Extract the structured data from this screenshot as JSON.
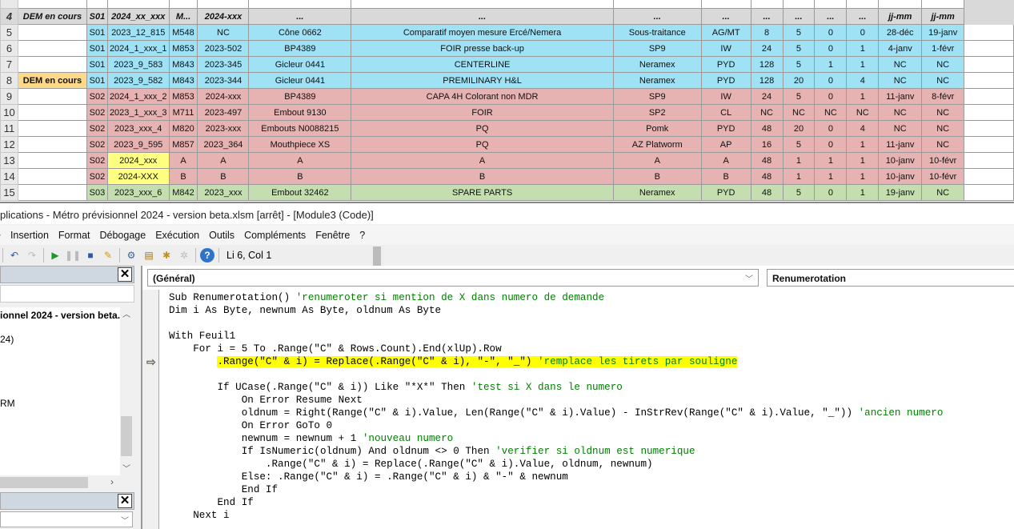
{
  "sheet": {
    "header_row": {
      "row": "4",
      "a": "DEM en cours",
      "cells": [
        "S01",
        "2024_xx_xxx",
        "M...",
        "2024-xxx",
        "...",
        "...",
        "...",
        "...",
        "...",
        "...",
        "...",
        "...",
        "jj-mm",
        "jj-mm"
      ]
    },
    "rows": [
      {
        "row": "5",
        "a": "",
        "color": "blue",
        "cells": [
          "S01",
          "2023_12_815",
          "M548",
          "NC",
          "Cône 0662",
          "Comparatif moyen mesure Ercé/Nemera",
          "Sous-traitance",
          "AG/MT",
          "8",
          "5",
          "0",
          "0",
          "28-déc",
          "19-janv"
        ]
      },
      {
        "row": "6",
        "a": "",
        "color": "blue",
        "cells": [
          "S01",
          "2024_1_xxx_1",
          "M853",
          "2023-502",
          "BP4389",
          "FOIR presse back-up",
          "SP9",
          "IW",
          "24",
          "5",
          "0",
          "1",
          "4-janv",
          "1-févr"
        ]
      },
      {
        "row": "7",
        "a": "",
        "color": "blue",
        "cells": [
          "S01",
          "2023_9_583",
          "M843",
          "2023-345",
          "Gicleur 0441",
          "CENTERLINE",
          "Neramex",
          "PYD",
          "128",
          "5",
          "1",
          "1",
          "NC",
          "NC"
        ]
      },
      {
        "row": "8",
        "a": "DEM en cours",
        "color": "blue",
        "cells": [
          "S01",
          "2023_9_582",
          "M843",
          "2023-344",
          "Gicleur 0441",
          "PREMILINARY H&L",
          "Neramex",
          "PYD",
          "128",
          "20",
          "0",
          "4",
          "NC",
          "NC"
        ]
      },
      {
        "row": "9",
        "a": "",
        "color": "pink",
        "cells": [
          "S02",
          "2024_1_xxx_2",
          "M853",
          "2024-xxx",
          "BP4389",
          "CAPA 4H Colorant non MDR",
          "SP9",
          "IW",
          "24",
          "5",
          "0",
          "1",
          "11-janv",
          "8-févr"
        ]
      },
      {
        "row": "10",
        "a": "",
        "color": "pink",
        "cells": [
          "S02",
          "2023_1_xxx_3",
          "M711",
          "2023-497",
          "Embout 9130",
          "FOIR",
          "SP2",
          "CL",
          "NC",
          "NC",
          "NC",
          "NC",
          "NC",
          "NC"
        ]
      },
      {
        "row": "11",
        "a": "",
        "color": "pink",
        "cells": [
          "S02",
          "2023_xxx_4",
          "M820",
          "2023-xxx",
          "Embouts N0088215",
          "PQ",
          "Pomk",
          "PYD",
          "48",
          "20",
          "0",
          "4",
          "NC",
          "NC"
        ]
      },
      {
        "row": "12",
        "a": "",
        "color": "pink",
        "cells": [
          "S02",
          "2023_9_595",
          "M857",
          "2023_364",
          "Mouthpiece XS",
          "PQ",
          "AZ Platworm",
          "AP",
          "16",
          "5",
          "0",
          "1",
          "11-janv",
          "NC"
        ]
      },
      {
        "row": "13",
        "a": "",
        "color": "pink",
        "yellow": true,
        "cells": [
          "S02",
          "2024_xxx",
          "A",
          "A",
          "A",
          "A",
          "A",
          "A",
          "48",
          "1",
          "1",
          "1",
          "10-janv",
          "10-févr"
        ]
      },
      {
        "row": "14",
        "a": "",
        "color": "pink",
        "yellow": true,
        "cells": [
          "S02",
          "2024-XXX",
          "B",
          "B",
          "B",
          "B",
          "B",
          "B",
          "48",
          "1",
          "1",
          "1",
          "10-janv",
          "10-févr"
        ]
      },
      {
        "row": "15",
        "a": "",
        "color": "green",
        "cells": [
          "S03",
          "2023_xxx_6",
          "M842",
          "2023_xxx",
          "Embout 32462",
          "SPARE PARTS",
          "Neramex",
          "PYD",
          "48",
          "5",
          "0",
          "1",
          "19-janv",
          "NC"
        ]
      }
    ]
  },
  "vbe": {
    "title": "plications - Métro prévisionnel 2024 - version beta.xlsm [arrêt] - [Module3 (Code)]",
    "menu": [
      "e",
      "Insertion",
      "Format",
      "Débogage",
      "Exécution",
      "Outils",
      "Compléments",
      "Fenêtre",
      "?"
    ],
    "cursor_pos": "Li 6, Col 1",
    "project_title": "ionnel 2024 - version beta.",
    "tree_items": [
      "24)",
      "RM"
    ],
    "object_combo": "(Général)",
    "proc_combo": "Renumerotation",
    "code": [
      {
        "i": 0,
        "c": "Sub Renumerotation() ",
        "m": "'renumeroter si mention de X dans numero de demande"
      },
      {
        "i": 0,
        "c": "Dim i As Byte, newnum As Byte, oldnum As Byte",
        "m": ""
      },
      {
        "i": 0,
        "c": "",
        "m": ""
      },
      {
        "i": 0,
        "c": "With Feuil1",
        "m": ""
      },
      {
        "i": 1,
        "c": "For i = 5 To .Range(\"C\" & Rows.Count).End(xlUp).Row",
        "m": ""
      },
      {
        "i": 2,
        "c": ".Range(\"C\" & i) = Replace(.Range(\"C\" & i), \"-\", \"_\") ",
        "m": "'remplace les tirets par souligne",
        "hl": true
      },
      {
        "i": 0,
        "c": "",
        "m": ""
      },
      {
        "i": 2,
        "c": "If UCase(.Range(\"C\" & i)) Like \"*X*\" Then ",
        "m": "'test si X dans le numero"
      },
      {
        "i": 3,
        "c": "On Error Resume Next",
        "m": ""
      },
      {
        "i": 3,
        "c": "oldnum = Right(Range(\"C\" & i).Value, Len(Range(\"C\" & i).Value) - InStrRev(Range(\"C\" & i).Value, \"_\")) ",
        "m": "'ancien numero"
      },
      {
        "i": 3,
        "c": "On Error GoTo 0",
        "m": ""
      },
      {
        "i": 3,
        "c": "newnum = newnum + 1 ",
        "m": "'nouveau numero"
      },
      {
        "i": 3,
        "c": "If IsNumeric(oldnum) And oldnum <> 0 Then ",
        "m": "'verifier si oldnum est numerique"
      },
      {
        "i": 4,
        "c": ".Range(\"C\" & i) = Replace(.Range(\"C\" & i).Value, oldnum, newnum)",
        "m": ""
      },
      {
        "i": 3,
        "c": "Else: .Range(\"C\" & i) = .Range(\"C\" & i) & \"-\" & newnum",
        "m": ""
      },
      {
        "i": 3,
        "c": "End If",
        "m": ""
      },
      {
        "i": 2,
        "c": "End If",
        "m": ""
      },
      {
        "i": 1,
        "c": "Next i",
        "m": ""
      }
    ]
  }
}
